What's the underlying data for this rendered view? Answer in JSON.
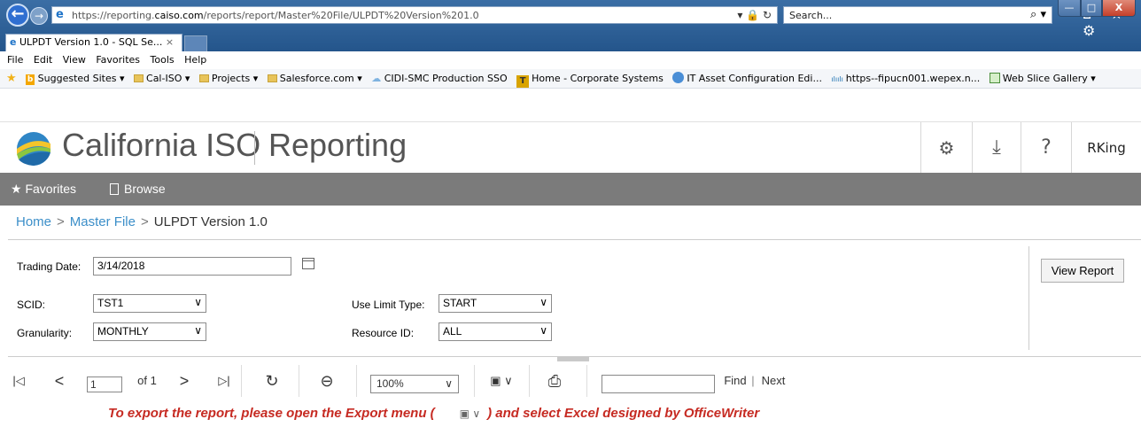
{
  "browser": {
    "url_prefix": "https://reporting.",
    "url_host": "caiso.com",
    "url_path": "/reports/report/Master%20File/ULPDT%20Version%201.0",
    "addr_icons": "▾ 🔒 ↻",
    "search_placeholder": "Search...",
    "search_icon": "⌕ ▾",
    "toolbar_icons": "⌂ ★ ⚙",
    "tab_title": "ULPDT Version 1.0 - SQL Se...",
    "tab_close": "×",
    "window_controls": {
      "min": "—",
      "max": "□",
      "close": "X"
    }
  },
  "menu": [
    "File",
    "Edit",
    "View",
    "Favorites",
    "Tools",
    "Help"
  ],
  "favorites_bar": {
    "suggested": "Suggested Sites ▾",
    "caliso": "Cal-ISO ▾",
    "projects": "Projects ▾",
    "salesforce": "Salesforce.com ▾",
    "cidi": "CIDI-SMC Production SSO",
    "home_corp": "Home - Corporate Systems",
    "it_asset": "IT Asset Configuration Edi...",
    "fipucn": "https--fipucn001.wepex.n...",
    "web_slice": "Web Slice Gallery ▾"
  },
  "app_header": {
    "brand": "California ISO",
    "product": "Reporting",
    "gear_glyph": "⚙",
    "download_glyph": "⤓",
    "help_glyph": "?",
    "user": "RKing"
  },
  "nav": {
    "favorites": "Favorites",
    "browse": "Browse",
    "star": "★"
  },
  "breadcrumb": {
    "home": "Home",
    "sep": ">",
    "master": "Master File",
    "current": "ULPDT Version 1.0"
  },
  "params": {
    "trading_date_label": "Trading Date:",
    "trading_date_value": "3/14/2018",
    "scid_label": "SCID:",
    "scid_value": "TST1",
    "granularity_label": "Granularity:",
    "granularity_value": "MONTHLY",
    "use_limit_label": "Use Limit Type:",
    "use_limit_value": "START",
    "resource_label": "Resource ID:",
    "resource_value": "ALL",
    "chevron": "∨",
    "view_report": "View Report"
  },
  "report_toolbar": {
    "first": "|◁",
    "prev": "<",
    "page": "1",
    "of": "of 1",
    "next": ">",
    "last": "▷|",
    "refresh": "↻",
    "back": "⊖",
    "zoom": "100%",
    "zoom_chev": "∨",
    "export": "▣ ∨",
    "print": "⎙",
    "find": "Find",
    "find_sep": "|",
    "next_label": "Next"
  },
  "export_note": {
    "before": "To export the report, please open the Export menu (",
    "icon": "▣ ∨",
    "after": ") and select Excel designed by OfficeWriter"
  }
}
